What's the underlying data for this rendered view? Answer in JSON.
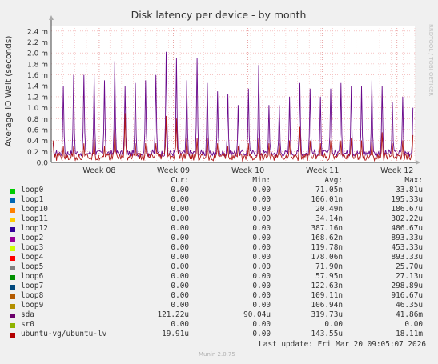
{
  "chart_data": {
    "type": "line",
    "title": "Disk latency per device - by month",
    "ylabel": "Average IO Wait (seconds)",
    "watermark": "RRDTOOL / TOBI OETIKER",
    "ylim": [
      0,
      2.5
    ],
    "y_ticks": [
      "0.0",
      "0.2 m",
      "0.4 m",
      "0.6 m",
      "0.8 m",
      "1.0 m",
      "1.2 m",
      "1.4 m",
      "1.6 m",
      "1.8 m",
      "2.0 m",
      "2.2 m",
      "2.4 m"
    ],
    "y_tick_values": [
      0,
      0.2,
      0.4,
      0.6,
      0.8,
      1.0,
      1.2,
      1.4,
      1.6,
      1.8,
      2.0,
      2.2,
      2.4
    ],
    "x_ticks": [
      "Week 08",
      "Week 09",
      "Week 10",
      "Week 11",
      "Week 12"
    ],
    "x_tick_fracs": [
      0.132,
      0.336,
      0.541,
      0.746,
      0.951
    ],
    "grid": true,
    "series": [
      {
        "name": "sda",
        "color": "#6a0a8c",
        "spike_values": [
          0.35,
          1.4,
          1.6,
          1.6,
          1.6,
          1.5,
          1.85,
          1.4,
          1.45,
          1.5,
          1.6,
          2.02,
          1.9,
          1.5,
          1.9,
          1.45,
          1.3,
          1.25,
          1.05,
          1.35,
          1.78,
          1.05,
          1.05,
          1.2,
          1.45,
          1.35,
          1.2,
          1.35,
          1.45,
          1.4,
          1.4,
          1.5,
          1.4,
          1.1,
          1.2,
          1.0
        ]
      },
      {
        "name": "ubuntu-vg/ubuntu-lv",
        "color": "#b01818",
        "spike_values": [
          0.4,
          0.3,
          0.3,
          0.35,
          0.45,
          0.3,
          0.6,
          0.9,
          0.35,
          0.35,
          0.35,
          0.85,
          0.8,
          0.45,
          0.45,
          0.45,
          0.35,
          0.3,
          0.3,
          0.35,
          0.45,
          0.35,
          0.35,
          0.4,
          0.65,
          0.4,
          0.35,
          0.4,
          0.4,
          0.45,
          0.4,
          0.4,
          0.55,
          0.35,
          0.4,
          0.5
        ]
      }
    ]
  },
  "legend": {
    "headers": {
      "cur": "Cur:",
      "min": "Min:",
      "avg": "Avg:",
      "max": "Max:"
    },
    "rows": [
      {
        "name": "loop0",
        "color": "#00cc00",
        "cur": "0.00",
        "min": "0.00",
        "avg": "71.05n",
        "max": "33.81u"
      },
      {
        "name": "loop1",
        "color": "#0066b3",
        "cur": "0.00",
        "min": "0.00",
        "avg": "106.01n",
        "max": "195.33u"
      },
      {
        "name": "loop10",
        "color": "#ff8000",
        "cur": "0.00",
        "min": "0.00",
        "avg": "20.49n",
        "max": "186.67u"
      },
      {
        "name": "loop11",
        "color": "#ffcc00",
        "cur": "0.00",
        "min": "0.00",
        "avg": "34.14n",
        "max": "302.22u"
      },
      {
        "name": "loop12",
        "color": "#330099",
        "cur": "0.00",
        "min": "0.00",
        "avg": "387.16n",
        "max": "486.67u"
      },
      {
        "name": "loop2",
        "color": "#990099",
        "cur": "0.00",
        "min": "0.00",
        "avg": "168.62n",
        "max": "893.33u"
      },
      {
        "name": "loop3",
        "color": "#ccff00",
        "cur": "0.00",
        "min": "0.00",
        "avg": "119.78n",
        "max": "453.33u"
      },
      {
        "name": "loop4",
        "color": "#ff0000",
        "cur": "0.00",
        "min": "0.00",
        "avg": "178.06n",
        "max": "893.33u"
      },
      {
        "name": "loop5",
        "color": "#808080",
        "cur": "0.00",
        "min": "0.00",
        "avg": "71.90n",
        "max": "25.70u"
      },
      {
        "name": "loop6",
        "color": "#008f00",
        "cur": "0.00",
        "min": "0.00",
        "avg": "57.95n",
        "max": "27.13u"
      },
      {
        "name": "loop7",
        "color": "#00487d",
        "cur": "0.00",
        "min": "0.00",
        "avg": "122.63n",
        "max": "298.89u"
      },
      {
        "name": "loop8",
        "color": "#b35a00",
        "cur": "0.00",
        "min": "0.00",
        "avg": "109.11n",
        "max": "916.67u"
      },
      {
        "name": "loop9",
        "color": "#b38f00",
        "cur": "0.00",
        "min": "0.00",
        "avg": "106.94n",
        "max": "46.35u"
      },
      {
        "name": "sda",
        "color": "#6b006b",
        "cur": "121.22u",
        "min": "90.04u",
        "avg": "319.73u",
        "max": "41.86m"
      },
      {
        "name": "sr0",
        "color": "#8fb300",
        "cur": "0.00",
        "min": "0.00",
        "avg": "0.00",
        "max": "0.00"
      },
      {
        "name": "ubuntu-vg/ubuntu-lv",
        "color": "#b30000",
        "cur": "19.91u",
        "min": "0.00",
        "avg": "143.55u",
        "max": "18.11m"
      }
    ]
  },
  "footer": {
    "last_update": "Last update: Fri Mar 20 09:05:07 2026",
    "version": "Munin 2.0.75"
  }
}
